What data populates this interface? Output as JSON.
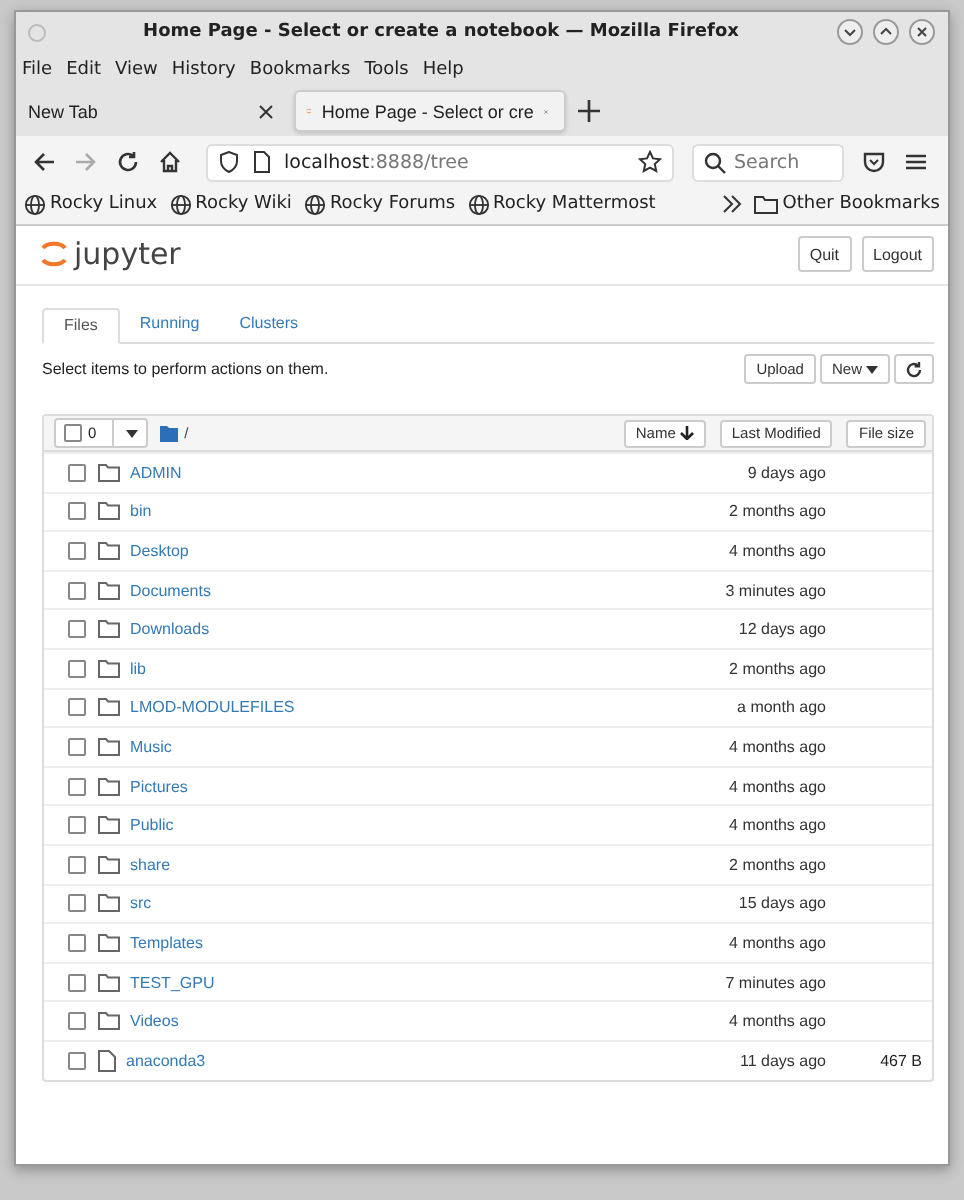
{
  "window": {
    "title": "Home Page - Select or create a notebook — Mozilla Firefox"
  },
  "menu": [
    "File",
    "Edit",
    "View",
    "History",
    "Bookmarks",
    "Tools",
    "Help"
  ],
  "browser_tabs": [
    {
      "label": "New Tab",
      "selected": false,
      "kind": "blank"
    },
    {
      "label": "Home Page - Select or cre",
      "selected": true,
      "kind": "jupyter"
    }
  ],
  "address": {
    "host": "localhost",
    "rest": ":8888/tree"
  },
  "search": {
    "placeholder": "Search"
  },
  "bookmarks": [
    "Rocky Linux",
    "Rocky Wiki",
    "Rocky Forums",
    "Rocky Mattermost"
  ],
  "other_bookmarks": "Other Bookmarks",
  "jupyter": {
    "logo": "jupyter",
    "buttons": [
      "Quit",
      "Logout"
    ],
    "tabs": [
      {
        "label": "Files",
        "selected": true
      },
      {
        "label": "Running",
        "selected": false
      },
      {
        "label": "Clusters",
        "selected": false
      }
    ],
    "hint": "Select items to perform actions on them.",
    "actions": [
      "Upload",
      "New"
    ],
    "selected_count": "0",
    "path": "/",
    "sort_buttons": [
      "Name",
      "Last Modified",
      "File size"
    ],
    "files": [
      {
        "name": "ADMIN",
        "kind": "folder",
        "modified": "9 days ago",
        "checked": false
      },
      {
        "name": "bin",
        "kind": "folder",
        "modified": "2 months ago",
        "checked": false
      },
      {
        "name": "Desktop",
        "kind": "folder",
        "modified": "4 months ago",
        "checked": false
      },
      {
        "name": "Documents",
        "kind": "folder",
        "modified": "3 minutes ago",
        "checked": false
      },
      {
        "name": "Downloads",
        "kind": "folder",
        "modified": "12 days ago",
        "checked": false
      },
      {
        "name": "lib",
        "kind": "folder",
        "modified": "2 months ago",
        "checked": false
      },
      {
        "name": "LMOD-MODULEFILES",
        "kind": "folder",
        "modified": "a month ago",
        "checked": false
      },
      {
        "name": "Music",
        "kind": "folder",
        "modified": "4 months ago",
        "checked": false
      },
      {
        "name": "Pictures",
        "kind": "folder",
        "modified": "4 months ago",
        "checked": false
      },
      {
        "name": "Public",
        "kind": "folder",
        "modified": "4 months ago",
        "checked": false
      },
      {
        "name": "share",
        "kind": "folder",
        "modified": "2 months ago",
        "checked": false
      },
      {
        "name": "src",
        "kind": "folder",
        "modified": "15 days ago",
        "checked": false
      },
      {
        "name": "Templates",
        "kind": "folder",
        "modified": "4 months ago",
        "checked": false
      },
      {
        "name": "TEST_GPU",
        "kind": "folder",
        "modified": "7 minutes ago",
        "checked": false
      },
      {
        "name": "Videos",
        "kind": "folder",
        "modified": "4 months ago",
        "checked": false
      },
      {
        "name": "anaconda3",
        "kind": "file",
        "modified": "11 days ago",
        "size": "467 B",
        "checked": false
      }
    ]
  }
}
